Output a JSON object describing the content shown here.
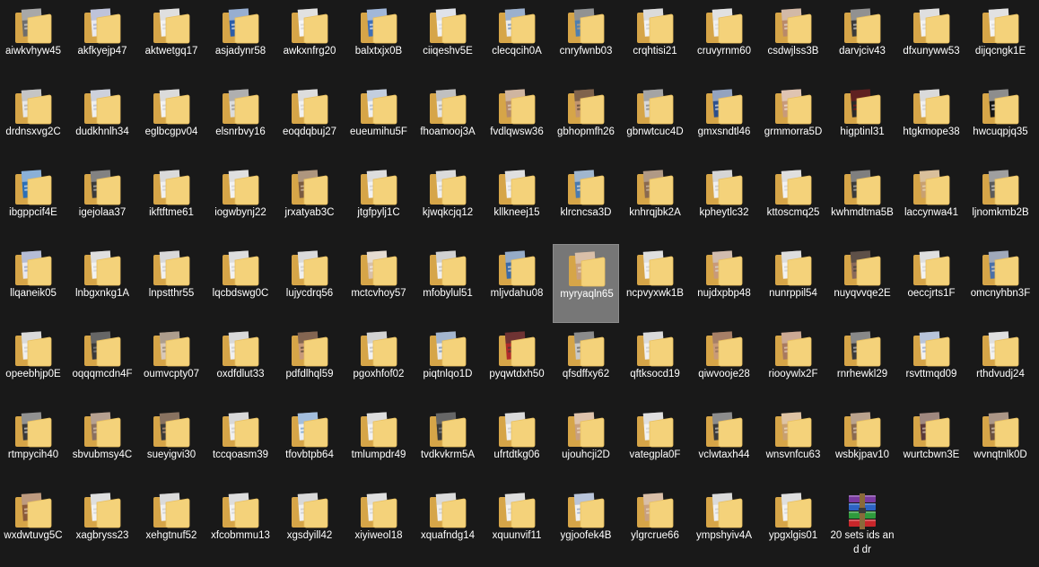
{
  "window": {
    "view": "large-icons",
    "background": "#191919",
    "selection_color": "#777777"
  },
  "colors": {
    "folder_back": "#d6a548",
    "folder_front": "#f4d27a",
    "folder_front_edge": "#e8bf5f",
    "archive_purple": "#7a3aa0",
    "archive_blue": "#2c63c4",
    "archive_green": "#2f9a3c",
    "archive_red": "#c8262a"
  },
  "items": [
    {
      "label": "aiwkvhyw45",
      "icon": "folder-icon",
      "preview": [
        "#6d6d6d",
        "#d9d9d9"
      ]
    },
    {
      "label": "akfkyejp47",
      "icon": "folder-icon",
      "preview": [
        "#e9e9ef",
        "#9aa4c8"
      ]
    },
    {
      "label": "aktwetgq17",
      "icon": "folder-icon",
      "preview": [
        "#f2f2f2",
        "#cfcfcf"
      ]
    },
    {
      "label": "asjadynr58",
      "icon": "folder-icon",
      "preview": [
        "#2b5da9",
        "#f0f0f0"
      ]
    },
    {
      "label": "awkxnfrg20",
      "icon": "folder-icon",
      "preview": [
        "#f5f5f5",
        "#d0d0d0"
      ]
    },
    {
      "label": "balxtxjx0B",
      "icon": "folder-icon",
      "preview": [
        "#3e6fb8",
        "#f3f3f3"
      ]
    },
    {
      "label": "ciiqeshv5E",
      "icon": "folder-icon",
      "preview": [
        "#f2f2f2",
        "#cfd6e2"
      ]
    },
    {
      "label": "clecqcih0A",
      "icon": "folder-icon",
      "preview": [
        "#eaeaea",
        "#5a7fb5"
      ]
    },
    {
      "label": "cnryfwnb03",
      "icon": "folder-icon",
      "preview": [
        "#4f7fb0",
        "#c9a27a"
      ]
    },
    {
      "label": "crqhtisi21",
      "icon": "folder-icon",
      "preview": [
        "#f2f2f2",
        "#c8c8c8"
      ]
    },
    {
      "label": "cruvyrnm60",
      "icon": "folder-icon",
      "preview": [
        "#f0f0f0",
        "#d6d6d6"
      ]
    },
    {
      "label": "csdwjlss3B",
      "icon": "folder-icon",
      "preview": [
        "#b98a6a",
        "#e8e0d8"
      ]
    },
    {
      "label": "darvjciv43",
      "icon": "folder-icon",
      "preview": [
        "#3a3a3a",
        "#d8d8d8"
      ]
    },
    {
      "label": "dfxunyww53",
      "icon": "folder-icon",
      "preview": [
        "#f2f2f2",
        "#cfcfcf"
      ]
    },
    {
      "label": "dijqcngk1E",
      "icon": "folder-icon",
      "preview": [
        "#f3f3f3",
        "#d4d4d4"
      ]
    },
    {
      "label": "drdnsxvg2C",
      "icon": "folder-icon",
      "preview": [
        "#e8e8e8",
        "#a8a8a8"
      ]
    },
    {
      "label": "dudkhnlh34",
      "icon": "folder-icon",
      "preview": [
        "#efefef",
        "#b0b8cc"
      ]
    },
    {
      "label": "eglbcgpv04",
      "icon": "folder-icon",
      "preview": [
        "#f2f2f2",
        "#c8c8c8"
      ]
    },
    {
      "label": "elsnrbvy16",
      "icon": "folder-icon",
      "preview": [
        "#dcdcdc",
        "#8a8a8a"
      ]
    },
    {
      "label": "eoqdqbuj27",
      "icon": "folder-icon",
      "preview": [
        "#f1f1f1",
        "#cccccc"
      ]
    },
    {
      "label": "eueumihu5F",
      "icon": "folder-icon",
      "preview": [
        "#f0f0f0",
        "#9fb3cf"
      ]
    },
    {
      "label": "fhoamooj3A",
      "icon": "folder-icon",
      "preview": [
        "#e6e6e6",
        "#a0a0a0"
      ]
    },
    {
      "label": "fvdlqwsw36",
      "icon": "folder-icon",
      "preview": [
        "#b48a6b",
        "#e6d9cc"
      ]
    },
    {
      "label": "gbhopmfh26",
      "icon": "folder-icon",
      "preview": [
        "#c2956f",
        "#4a3a30"
      ]
    },
    {
      "label": "gbnwtcuc4D",
      "icon": "folder-icon",
      "preview": [
        "#d8d8d8",
        "#7a7a7a"
      ]
    },
    {
      "label": "gmxsndtl46",
      "icon": "folder-icon",
      "preview": [
        "#2c4f8c",
        "#e9e9e9"
      ]
    },
    {
      "label": "grmmorra5D",
      "icon": "folder-icon",
      "preview": [
        "#c89a7a",
        "#f3e8e0"
      ]
    },
    {
      "label": "higptinl31",
      "icon": "folder-icon",
      "preview": [
        "#2a2a2a",
        "#8a1a1a"
      ]
    },
    {
      "label": "htgkmope38",
      "icon": "folder-icon",
      "preview": [
        "#f0f0f0",
        "#c8c8c8"
      ]
    },
    {
      "label": "hwcuqpjq35",
      "icon": "folder-icon",
      "preview": [
        "#151515",
        "#f1f1f1"
      ]
    },
    {
      "label": "ibgppcif4E",
      "icon": "folder-icon",
      "preview": [
        "#2b6fb8",
        "#d9e6f2"
      ]
    },
    {
      "label": "igejolaa37",
      "icon": "folder-icon",
      "preview": [
        "#3a3a3a",
        "#bdbdbd"
      ]
    },
    {
      "label": "ikftftme61",
      "icon": "folder-icon",
      "preview": [
        "#f0f0f0",
        "#c8c8c8"
      ]
    },
    {
      "label": "iogwbynj22",
      "icon": "folder-icon",
      "preview": [
        "#f2f2f2",
        "#cfcfcf"
      ]
    },
    {
      "label": "jrxatyab3C",
      "icon": "folder-icon",
      "preview": [
        "#7a5a40",
        "#d8c8b0"
      ]
    },
    {
      "label": "jtgfpylj1C",
      "icon": "folder-icon",
      "preview": [
        "#f2f2f2",
        "#cccccc"
      ]
    },
    {
      "label": "kjwqkcjq12",
      "icon": "folder-icon",
      "preview": [
        "#f0f0f0",
        "#c9c9c9"
      ]
    },
    {
      "label": "kllkneej15",
      "icon": "folder-icon",
      "preview": [
        "#f1f1f1",
        "#cfcfcf"
      ]
    },
    {
      "label": "klrcncsa3D",
      "icon": "folder-icon",
      "preview": [
        "#4a7ab0",
        "#e8e8e8"
      ]
    },
    {
      "label": "knhrqjbk2A",
      "icon": "folder-icon",
      "preview": [
        "#8a6a50",
        "#d0c0b0"
      ]
    },
    {
      "label": "kpheytlc32",
      "icon": "folder-icon",
      "preview": [
        "#f0f0f0",
        "#c0c0c0"
      ]
    },
    {
      "label": "kttoscmq25",
      "icon": "folder-icon",
      "preview": [
        "#f2f2f2",
        "#d0d0d0"
      ]
    },
    {
      "label": "kwhmdtma5B",
      "icon": "folder-icon",
      "preview": [
        "#3a3a3a",
        "#b8b8b8"
      ]
    },
    {
      "label": "laccynwa41",
      "icon": "folder-icon",
      "preview": [
        "#c8a070",
        "#e8d8c0"
      ]
    },
    {
      "label": "ljnomkmb2B",
      "icon": "folder-icon",
      "preview": [
        "#5a5a5a",
        "#d8d8d8"
      ]
    },
    {
      "label": "llqaneik05",
      "icon": "folder-icon",
      "preview": [
        "#e8e8ef",
        "#8a98c0"
      ]
    },
    {
      "label": "lnbgxnkg1A",
      "icon": "folder-icon",
      "preview": [
        "#f2f2f2",
        "#cfcfcf"
      ]
    },
    {
      "label": "lnpstthr55",
      "icon": "folder-icon",
      "preview": [
        "#f0f0f0",
        "#c4c4c4"
      ]
    },
    {
      "label": "lqcbdswg0C",
      "icon": "folder-icon",
      "preview": [
        "#f2f2f2",
        "#cccccc"
      ]
    },
    {
      "label": "lujycdrq56",
      "icon": "folder-icon",
      "preview": [
        "#f0f0f0",
        "#c8c8c8"
      ]
    },
    {
      "label": "mctcvhoy57",
      "icon": "folder-icon",
      "preview": [
        "#d8c0a8",
        "#f2f2f2"
      ]
    },
    {
      "label": "mfobylul51",
      "icon": "folder-icon",
      "preview": [
        "#f0f0f0",
        "#b8b8b8"
      ]
    },
    {
      "label": "mljvdahu08",
      "icon": "folder-icon",
      "preview": [
        "#3a6aa8",
        "#e0e0e0"
      ]
    },
    {
      "label": "myryaqln65",
      "icon": "folder-icon",
      "preview": [
        "#c8a080",
        "#e8d8c8"
      ],
      "selected": true
    },
    {
      "label": "ncpvyxwk1B",
      "icon": "folder-icon",
      "preview": [
        "#f2f2f2",
        "#cfcfcf"
      ]
    },
    {
      "label": "nujdxpbp48",
      "icon": "folder-icon",
      "preview": [
        "#c89a7a",
        "#d8d8d8"
      ]
    },
    {
      "label": "nunrppil54",
      "icon": "folder-icon",
      "preview": [
        "#f2f2f2",
        "#cccccc"
      ]
    },
    {
      "label": "nuyqvvqe2E",
      "icon": "folder-icon",
      "preview": [
        "#8a6a5a",
        "#3a3a3a"
      ]
    },
    {
      "label": "oeccjrts1F",
      "icon": "folder-icon",
      "preview": [
        "#f2f2f2",
        "#d0d0d0"
      ]
    },
    {
      "label": "omcnyhbn3F",
      "icon": "folder-icon",
      "preview": [
        "#4a70a8",
        "#e8d8c8"
      ]
    },
    {
      "label": "opeebhjp0E",
      "icon": "folder-icon",
      "preview": [
        "#f0f0f0",
        "#c8c8c8"
      ]
    },
    {
      "label": "oqqqmcdn4F",
      "icon": "folder-icon",
      "preview": [
        "#3a3a3a",
        "#8a8a8a"
      ]
    },
    {
      "label": "oumvcpty07",
      "icon": "folder-icon",
      "preview": [
        "#d8c8b8",
        "#8a7a6a"
      ]
    },
    {
      "label": "oxdfdlut33",
      "icon": "folder-icon",
      "preview": [
        "#f0f0f0",
        "#c4c4c4"
      ]
    },
    {
      "label": "pdfdlhql59",
      "icon": "folder-icon",
      "preview": [
        "#c89a7a",
        "#4a3a30"
      ]
    },
    {
      "label": "pgoxhfof02",
      "icon": "folder-icon",
      "preview": [
        "#f2f2f2",
        "#b8b8b8"
      ]
    },
    {
      "label": "piqtnlqo1D",
      "icon": "folder-icon",
      "preview": [
        "#e8e8e8",
        "#6a8ab8"
      ]
    },
    {
      "label": "pyqwtdxh50",
      "icon": "folder-icon",
      "preview": [
        "#b02a2a",
        "#3a3a3a"
      ]
    },
    {
      "label": "qfsdffxy62",
      "icon": "folder-icon",
      "preview": [
        "#c8c8c8",
        "#5a5a5a"
      ]
    },
    {
      "label": "qftksocd19",
      "icon": "folder-icon",
      "preview": [
        "#f0f0f0",
        "#c8c8c8"
      ]
    },
    {
      "label": "qiwvooje28",
      "icon": "folder-icon",
      "preview": [
        "#c89a78",
        "#8a6a5a"
      ]
    },
    {
      "label": "riooywlx2F",
      "icon": "folder-icon",
      "preview": [
        "#a87a60",
        "#e8d0c0"
      ]
    },
    {
      "label": "rnrhewkl29",
      "icon": "folder-icon",
      "preview": [
        "#3a3a3a",
        "#c8c8c8"
      ]
    },
    {
      "label": "rsvttmqd09",
      "icon": "folder-icon",
      "preview": [
        "#f0f0f0",
        "#8aa0c8"
      ]
    },
    {
      "label": "rthdvudj24",
      "icon": "folder-icon",
      "preview": [
        "#f2f2f2",
        "#cfcfcf"
      ]
    },
    {
      "label": "rtmpycih40",
      "icon": "folder-icon",
      "preview": [
        "#3a3a3a",
        "#d8d8d8"
      ]
    },
    {
      "label": "sbvubmsy4C",
      "icon": "folder-icon",
      "preview": [
        "#8a7060",
        "#d8c8b8"
      ]
    },
    {
      "label": "sueyigvi30",
      "icon": "folder-icon",
      "preview": [
        "#3a3a3a",
        "#c8a080"
      ]
    },
    {
      "label": "tccqoasm39",
      "icon": "folder-icon",
      "preview": [
        "#f0f0f0",
        "#c4c4c4"
      ]
    },
    {
      "label": "tfovbtpb64",
      "icon": "folder-icon",
      "preview": [
        "#e8eef5",
        "#6a98c8"
      ]
    },
    {
      "label": "tmlumpdr49",
      "icon": "folder-icon",
      "preview": [
        "#f2f2f2",
        "#cccccc"
      ]
    },
    {
      "label": "tvdkvkrm5A",
      "icon": "folder-icon",
      "preview": [
        "#3a3a3a",
        "#8a8a8a"
      ]
    },
    {
      "label": "ufrtdtkg06",
      "icon": "folder-icon",
      "preview": [
        "#f0f0f0",
        "#c8c8c8"
      ]
    },
    {
      "label": "ujouhcji2D",
      "icon": "folder-icon",
      "preview": [
        "#c8a080",
        "#f0e0d0"
      ]
    },
    {
      "label": "vategpla0F",
      "icon": "folder-icon",
      "preview": [
        "#f2f2f2",
        "#cfcfcf"
      ]
    },
    {
      "label": "vclwtaxh44",
      "icon": "folder-icon",
      "preview": [
        "#3a3a3a",
        "#d0d0d0"
      ]
    },
    {
      "label": "wnsvnfcu63",
      "icon": "folder-icon",
      "preview": [
        "#c8a070",
        "#f0e0d0"
      ]
    },
    {
      "label": "wsbkjpav10",
      "icon": "folder-icon",
      "preview": [
        "#8a6a50",
        "#e0d0c0"
      ]
    },
    {
      "label": "wurtcbwn3E",
      "icon": "folder-icon",
      "preview": [
        "#5a3a3a",
        "#d8c8b8"
      ]
    },
    {
      "label": "wvnqtnlk0D",
      "icon": "folder-icon",
      "preview": [
        "#6a5040",
        "#e0d0c0"
      ]
    },
    {
      "label": "wxdwtuvg5C",
      "icon": "folder-icon",
      "preview": [
        "#8a5a3a",
        "#e8d0b8"
      ]
    },
    {
      "label": "xagbryss23",
      "icon": "folder-icon",
      "preview": [
        "#f2f2f2",
        "#cfcfcf"
      ]
    },
    {
      "label": "xehgtnuf52",
      "icon": "folder-icon",
      "preview": [
        "#f0f0f0",
        "#c8c8c8"
      ]
    },
    {
      "label": "xfcobmmu13",
      "icon": "folder-icon",
      "preview": [
        "#f2f2f2",
        "#cccccc"
      ]
    },
    {
      "label": "xgsdyill42",
      "icon": "folder-icon",
      "preview": [
        "#f0f0f0",
        "#c4c4c4"
      ]
    },
    {
      "label": "xiyiweol18",
      "icon": "folder-icon",
      "preview": [
        "#f2f2f2",
        "#cfcfcf"
      ]
    },
    {
      "label": "xquafndg14",
      "icon": "folder-icon",
      "preview": [
        "#f0f0f0",
        "#c8c8c8"
      ]
    },
    {
      "label": "xquunvif11",
      "icon": "folder-icon",
      "preview": [
        "#f2f2f2",
        "#cccccc"
      ]
    },
    {
      "label": "ygjoofek4B",
      "icon": "folder-icon",
      "preview": [
        "#f0f0f0",
        "#8aa0c8"
      ]
    },
    {
      "label": "ylgrcrue66",
      "icon": "folder-icon",
      "preview": [
        "#c8a080",
        "#e8d8c8"
      ]
    },
    {
      "label": "ympshyiv4A",
      "icon": "folder-icon",
      "preview": [
        "#f0f0f0",
        "#c8c8c8"
      ]
    },
    {
      "label": "ypgxlgis01",
      "icon": "folder-icon",
      "preview": [
        "#f2f2f2",
        "#cfcfcf"
      ]
    },
    {
      "label": "20 sets ids and dr",
      "icon": "winrar-archive-icon",
      "preview": []
    }
  ]
}
